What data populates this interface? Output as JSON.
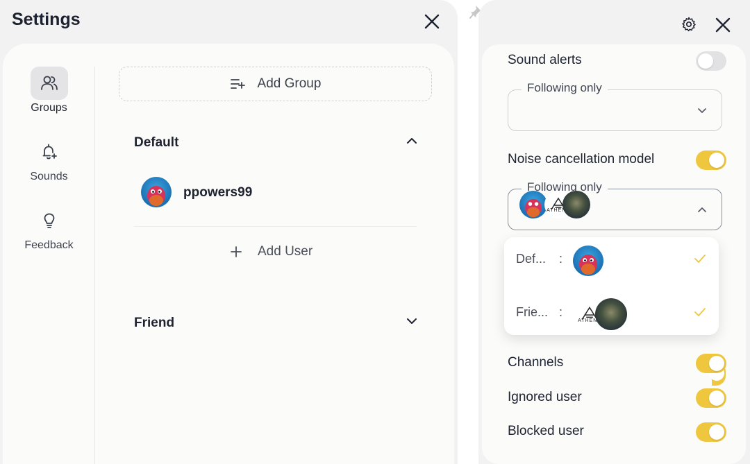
{
  "left": {
    "title": "Settings",
    "nav": [
      {
        "label": "Groups",
        "icon": "users-icon",
        "active": true
      },
      {
        "label": "Sounds",
        "icon": "bell-plus-icon",
        "active": false
      },
      {
        "label": "Feedback",
        "icon": "lightbulb-icon",
        "active": false
      }
    ],
    "add_group_label": "Add Group",
    "groups": [
      {
        "name": "Default",
        "expanded": true,
        "users": [
          {
            "name": "ppowers99"
          }
        ],
        "add_user_label": "Add User"
      },
      {
        "name": "Friend",
        "expanded": false
      }
    ]
  },
  "right": {
    "settings": [
      {
        "label": "Sound alerts",
        "on": false
      },
      {
        "label": "Noise cancellation model",
        "on": true
      },
      {
        "label": "Channels",
        "on": true
      },
      {
        "label": "Ignored user",
        "on": true
      },
      {
        "label": "Blocked user",
        "on": true
      }
    ],
    "select1": {
      "legend": "Following only"
    },
    "select2": {
      "legend": "Following only"
    },
    "dropdown": [
      {
        "name": "Def...",
        "separator": ":",
        "checked": true
      },
      {
        "name": "Frie...",
        "separator": ":",
        "checked": true
      }
    ],
    "athena_logo_text": "ATHENA"
  },
  "colors": {
    "accent_toggle": "#eec73f",
    "panel_bg": "#fbfbf9",
    "window_bg": "#f3f2f3"
  }
}
